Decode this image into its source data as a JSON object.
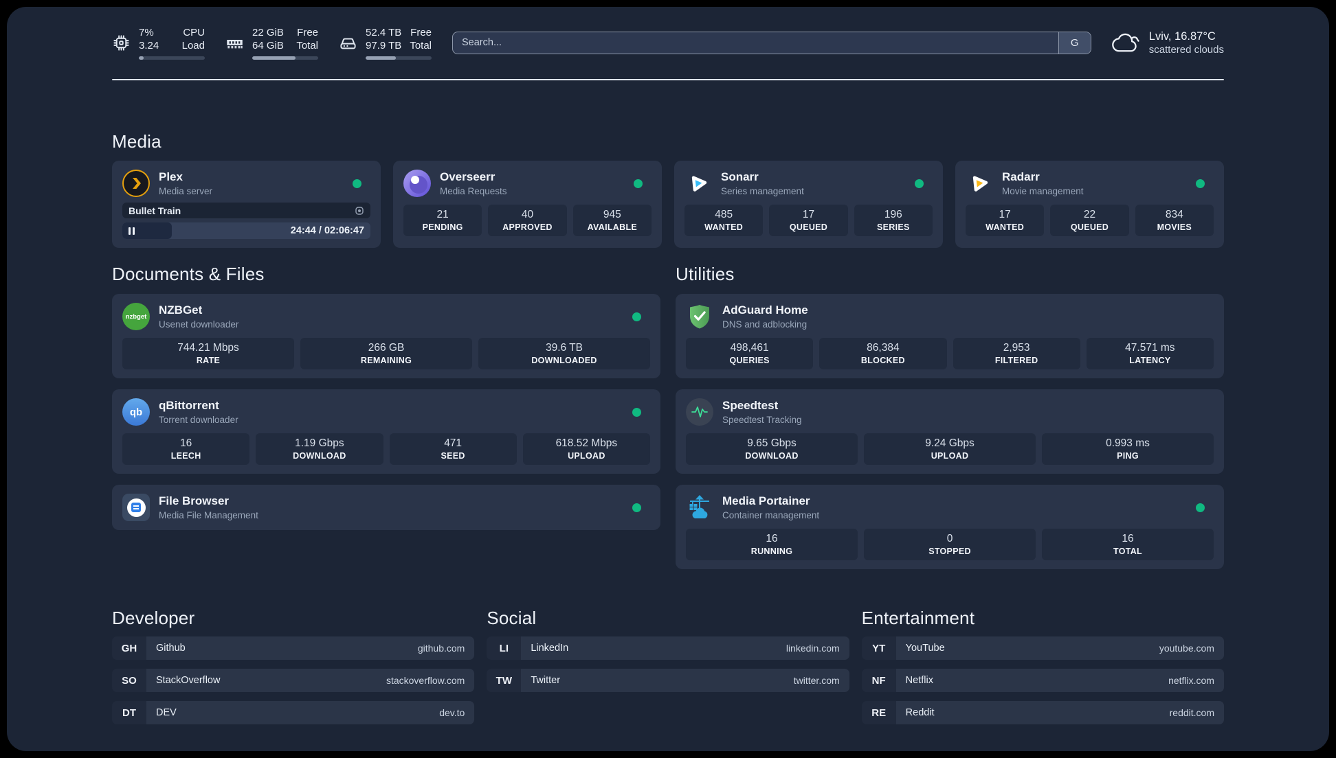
{
  "colors": {
    "accent_green": "#10b981",
    "panel_bg": "#1c2536",
    "card_bg": "#2a3449"
  },
  "topbar": {
    "cpu": {
      "value_top": "7%",
      "value_bottom": "3.24",
      "label_top": "CPU",
      "label_bottom": "Load",
      "progress": 7
    },
    "ram": {
      "value_top": "22 GiB",
      "value_bottom": "64 GiB",
      "label_top": "Free",
      "label_bottom": "Total",
      "progress": 66
    },
    "disk": {
      "value_top": "52.4 TB",
      "value_bottom": "97.9 TB",
      "label_top": "Free",
      "label_bottom": "Total",
      "progress": 46
    },
    "search": {
      "placeholder": "Search...",
      "provider": "G"
    },
    "weather": {
      "location_temp": "Lviv, 16.87°C",
      "condition": "scattered clouds"
    }
  },
  "media": {
    "title": "Media",
    "plex": {
      "name": "Plex",
      "desc": "Media server",
      "now_playing": "Bullet Train",
      "time": "24:44 / 02:06:47",
      "progress": 20
    },
    "overseerr": {
      "name": "Overseerr",
      "desc": "Media Requests",
      "stats": [
        {
          "value": "21",
          "label": "PENDING"
        },
        {
          "value": "40",
          "label": "APPROVED"
        },
        {
          "value": "945",
          "label": "AVAILABLE"
        }
      ]
    },
    "sonarr": {
      "name": "Sonarr",
      "desc": "Series management",
      "stats": [
        {
          "value": "485",
          "label": "WANTED"
        },
        {
          "value": "17",
          "label": "QUEUED"
        },
        {
          "value": "196",
          "label": "SERIES"
        }
      ]
    },
    "radarr": {
      "name": "Radarr",
      "desc": "Movie management",
      "stats": [
        {
          "value": "17",
          "label": "WANTED"
        },
        {
          "value": "22",
          "label": "QUEUED"
        },
        {
          "value": "834",
          "label": "MOVIES"
        }
      ]
    }
  },
  "documents": {
    "title": "Documents & Files",
    "nzbget": {
      "name": "NZBGet",
      "desc": "Usenet downloader",
      "icon_text": "nzbget",
      "stats": [
        {
          "value": "744.21 Mbps",
          "label": "RATE"
        },
        {
          "value": "266 GB",
          "label": "REMAINING"
        },
        {
          "value": "39.6 TB",
          "label": "DOWNLOADED"
        }
      ]
    },
    "qbittorrent": {
      "name": "qBittorrent",
      "desc": "Torrent downloader",
      "icon_text": "qb",
      "stats": [
        {
          "value": "16",
          "label": "LEECH"
        },
        {
          "value": "1.19 Gbps",
          "label": "DOWNLOAD"
        },
        {
          "value": "471",
          "label": "SEED"
        },
        {
          "value": "618.52 Mbps",
          "label": "UPLOAD"
        }
      ]
    },
    "filebrowser": {
      "name": "File Browser",
      "desc": "Media File Management"
    }
  },
  "utilities": {
    "title": "Utilities",
    "adguard": {
      "name": "AdGuard Home",
      "desc": "DNS and adblocking",
      "stats": [
        {
          "value": "498,461",
          "label": "QUERIES"
        },
        {
          "value": "86,384",
          "label": "BLOCKED"
        },
        {
          "value": "2,953",
          "label": "FILTERED"
        },
        {
          "value": "47.571 ms",
          "label": "LATENCY"
        }
      ]
    },
    "speedtest": {
      "name": "Speedtest",
      "desc": "Speedtest Tracking",
      "stats": [
        {
          "value": "9.65 Gbps",
          "label": "DOWNLOAD"
        },
        {
          "value": "9.24 Gbps",
          "label": "UPLOAD"
        },
        {
          "value": "0.993 ms",
          "label": "PING"
        }
      ]
    },
    "portainer": {
      "name": "Media Portainer",
      "desc": "Container management",
      "stats": [
        {
          "value": "16",
          "label": "RUNNING"
        },
        {
          "value": "0",
          "label": "STOPPED"
        },
        {
          "value": "16",
          "label": "TOTAL"
        }
      ]
    }
  },
  "links": {
    "developer": {
      "title": "Developer",
      "items": [
        {
          "abbr": "GH",
          "name": "Github",
          "url": "github.com"
        },
        {
          "abbr": "SO",
          "name": "StackOverflow",
          "url": "stackoverflow.com"
        },
        {
          "abbr": "DT",
          "name": "DEV",
          "url": "dev.to"
        }
      ]
    },
    "social": {
      "title": "Social",
      "items": [
        {
          "abbr": "LI",
          "name": "LinkedIn",
          "url": "linkedin.com"
        },
        {
          "abbr": "TW",
          "name": "Twitter",
          "url": "twitter.com"
        }
      ]
    },
    "entertainment": {
      "title": "Entertainment",
      "items": [
        {
          "abbr": "YT",
          "name": "YouTube",
          "url": "youtube.com"
        },
        {
          "abbr": "NF",
          "name": "Netflix",
          "url": "netflix.com"
        },
        {
          "abbr": "RE",
          "name": "Reddit",
          "url": "reddit.com"
        }
      ]
    }
  }
}
